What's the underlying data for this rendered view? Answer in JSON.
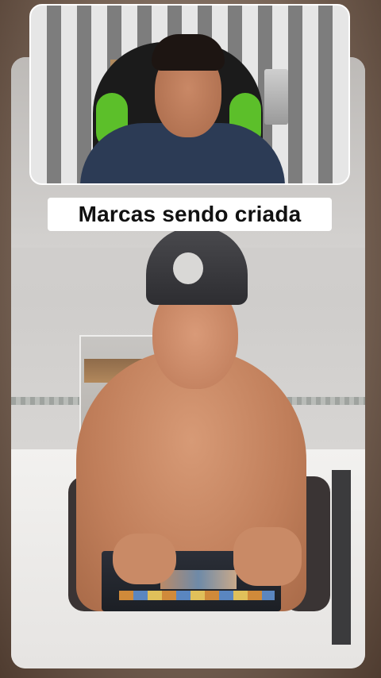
{
  "caption": {
    "text": "Marcas sendo criada"
  },
  "colors": {
    "caption_background": "#ffffff",
    "caption_text": "#111111",
    "reaction_border": "#ffffff",
    "chair_accent": "#5cbf2a"
  }
}
